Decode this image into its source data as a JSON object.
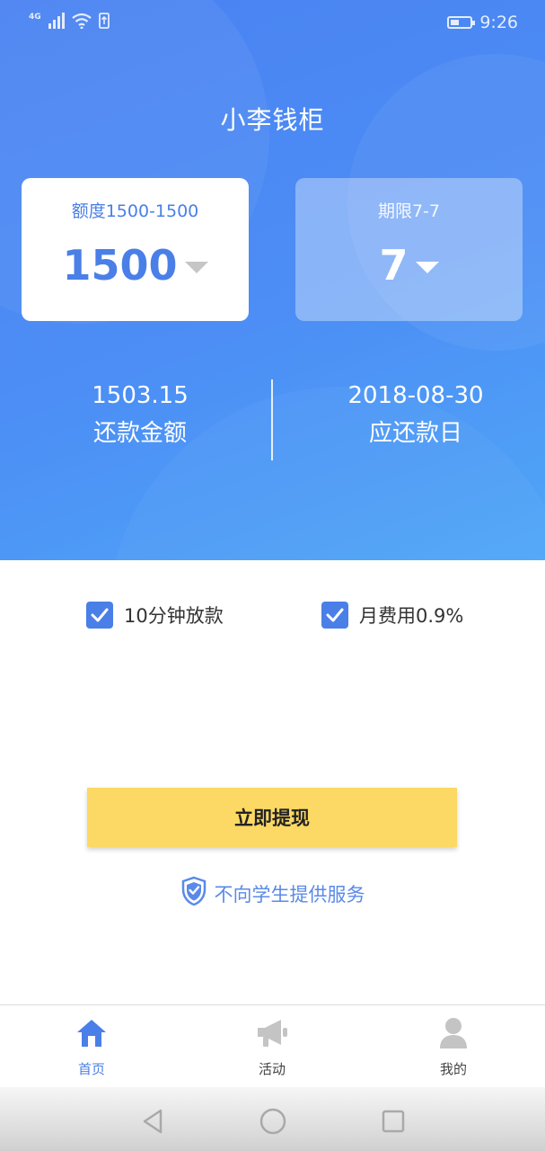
{
  "status_bar": {
    "network": "4G",
    "time": "9:26",
    "battery_level": 0.45
  },
  "app": {
    "title": "小李钱柜"
  },
  "amount_card": {
    "label": "额度1500-1500",
    "value": "1500"
  },
  "term_card": {
    "label": "期限7-7",
    "value": "7"
  },
  "stats": {
    "repay_amount": {
      "value": "1503.15",
      "label": "还款金额"
    },
    "due_date": {
      "value": "2018-08-30",
      "label": "应还款日"
    }
  },
  "features": [
    {
      "label": "10分钟放款",
      "checked": true
    },
    {
      "label": "月费用0.9%",
      "checked": true
    }
  ],
  "cta": {
    "label": "立即提现"
  },
  "notice": {
    "text": "不向学生提供服务"
  },
  "bottom_nav": [
    {
      "label": "首页",
      "icon": "home-icon",
      "active": true
    },
    {
      "label": "活动",
      "icon": "megaphone-icon",
      "active": false
    },
    {
      "label": "我的",
      "icon": "user-icon",
      "active": false
    }
  ],
  "colors": {
    "primary": "#4a7fe8",
    "cta": "#fcd964",
    "nav_inactive": "#c4c4c4"
  }
}
